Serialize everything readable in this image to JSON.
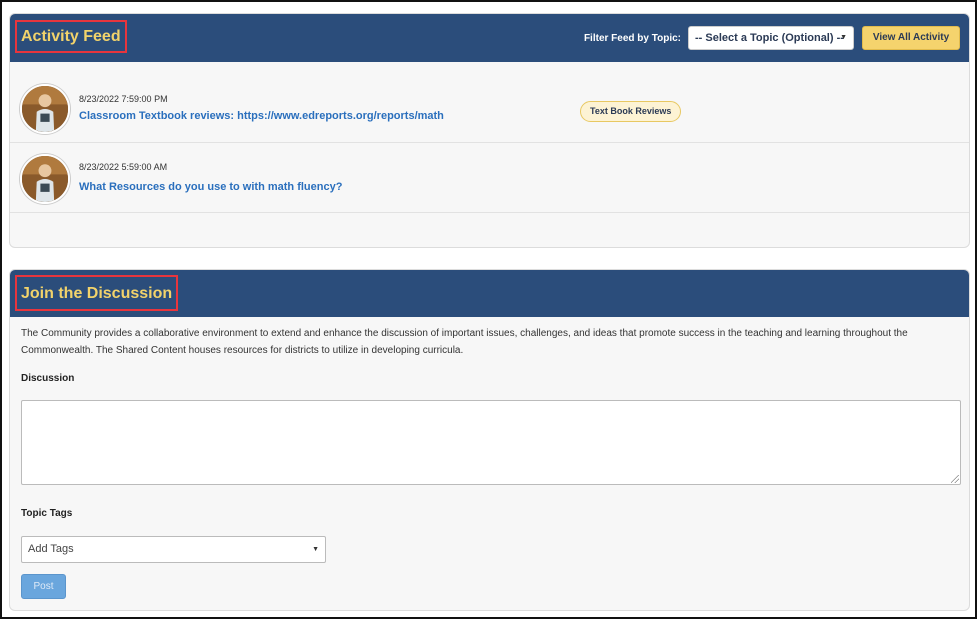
{
  "activity_feed": {
    "title": "Activity Feed",
    "filter_label": "Filter Feed by Topic:",
    "topic_select": {
      "selected": "-- Select a Topic (Optional) --"
    },
    "view_all_label": "View All Activity",
    "items": [
      {
        "timestamp": "8/23/2022 7:59:00 PM",
        "link_text": "Classroom Textbook reviews: https://www.edreports.org/reports/math",
        "tag": "Text Book Reviews"
      },
      {
        "timestamp": "8/23/2022 5:59:00 AM",
        "link_text": "What Resources do you use to with math fluency?",
        "tag": ""
      }
    ]
  },
  "discussion": {
    "title": "Join the Discussion",
    "description": "The Community provides a collaborative environment to extend and enhance the discussion of important issues, challenges, and ideas that promote success in the teaching and learning throughout the Commonwealth. The Shared Content houses resources for districts to utilize in developing curricula.",
    "discussion_label": "Discussion",
    "discussion_value": "",
    "topic_tags_label": "Topic Tags",
    "tags_placeholder": "Add Tags",
    "post_label": "Post"
  },
  "colors": {
    "header_bg": "#2b4d7b",
    "title_text": "#f2d36b",
    "highlight_box": "#e8353d",
    "link": "#2a6fbd",
    "accent_button": "#f5d36d",
    "post_button": "#6aa6dd"
  }
}
